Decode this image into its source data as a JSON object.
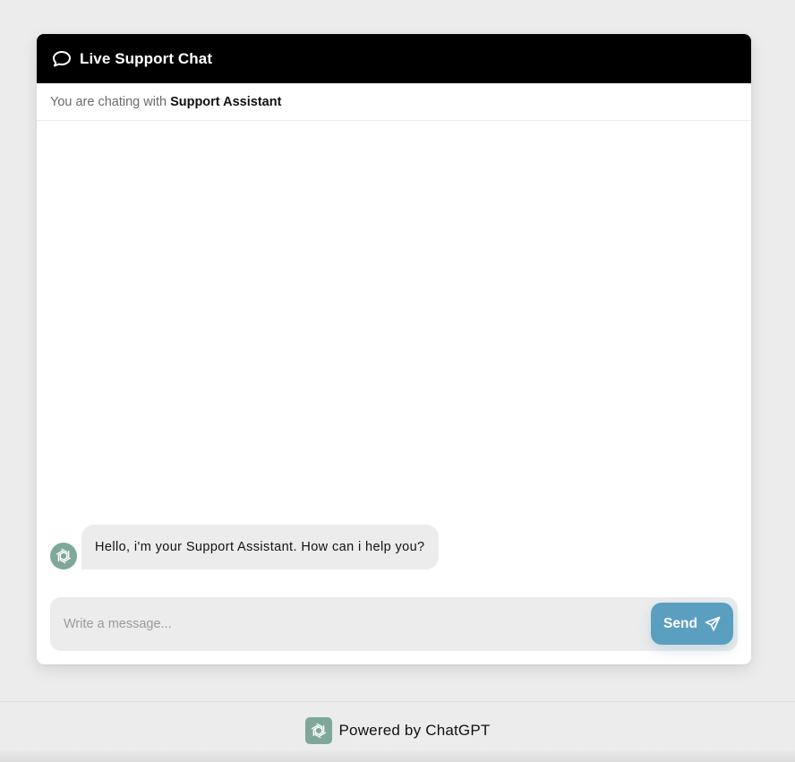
{
  "header": {
    "title": "Live Support Chat",
    "icon": "chat-bubble-icon"
  },
  "subheader": {
    "prefix": "You are chating with",
    "agent_name": "Support Assistant"
  },
  "messages": [
    {
      "sender": "assistant",
      "avatar_icon": "openai-logo-icon",
      "text": "Hello, i'm your Support Assistant. How can i help you?"
    }
  ],
  "composer": {
    "placeholder": "Write a message...",
    "value": "",
    "send_label": "Send",
    "send_icon": "paper-plane-icon"
  },
  "footer": {
    "logo_icon": "openai-logo-icon",
    "text": "Powered by ChatGPT"
  },
  "colors": {
    "page_background": "#ececec",
    "header_background": "#000000",
    "bubble_background": "#ececec",
    "send_button": "#5a9fc0",
    "avatar_background": "#7fa89a"
  }
}
